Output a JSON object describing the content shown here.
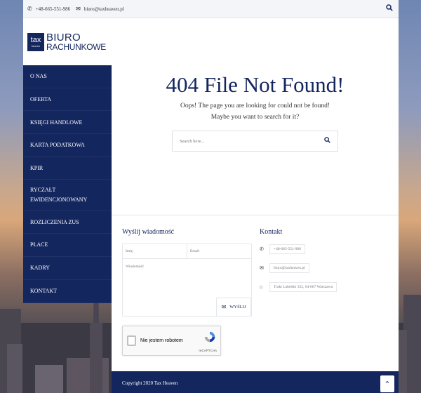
{
  "topbar": {
    "phone": "+48-665-551-986",
    "email": "biuro@taxheaven.pl"
  },
  "logo": {
    "box_top": "tax",
    "box_bottom": "heaven",
    "line1": "BIURO",
    "line2": "RACHUNKOWE"
  },
  "nav": {
    "items": [
      {
        "label": "O NAS"
      },
      {
        "label": "OFERTA"
      },
      {
        "label": "KSIĘGI HANDLOWE"
      },
      {
        "label": "KARTA PODATKOWA"
      },
      {
        "label": "KPIR"
      },
      {
        "label": "RYCZAŁT EWIDENCJONOWANY"
      },
      {
        "label": "ROZLICZENIA ZUS"
      },
      {
        "label": "PŁACE"
      },
      {
        "label": "KADRY"
      },
      {
        "label": "KONTAKT"
      }
    ]
  },
  "main": {
    "title": "404 File Not Found!",
    "message": "Oops! The page you are looking for could not be found! Maybe you want to search for it?",
    "search_placeholder": "Search here..."
  },
  "form": {
    "title": "Wyślij wiadomość",
    "name_placeholder": "Imię",
    "email_placeholder": "Email",
    "message_placeholder": "Wiadomość",
    "send_label": "WYŚLIJ"
  },
  "recaptcha": {
    "label": "Nie jestem robotem",
    "brand": "reCAPTCHA"
  },
  "contact": {
    "title": "Kontakt",
    "phone": "+48-665-551-986",
    "email": "biuro@taxheaven.pl",
    "address": "Trakt Lubelski 352, 04-667 Warszawa"
  },
  "footer": {
    "copyright": "Copyright 2020 Tax Heaven"
  },
  "colors": {
    "brand": "#14265e",
    "background_top": "#6f86b3",
    "background_sunset": "#d9a77a"
  },
  "icons": [
    "phone-icon",
    "mail-icon",
    "search-icon",
    "home-icon",
    "chevron-up-icon"
  ]
}
